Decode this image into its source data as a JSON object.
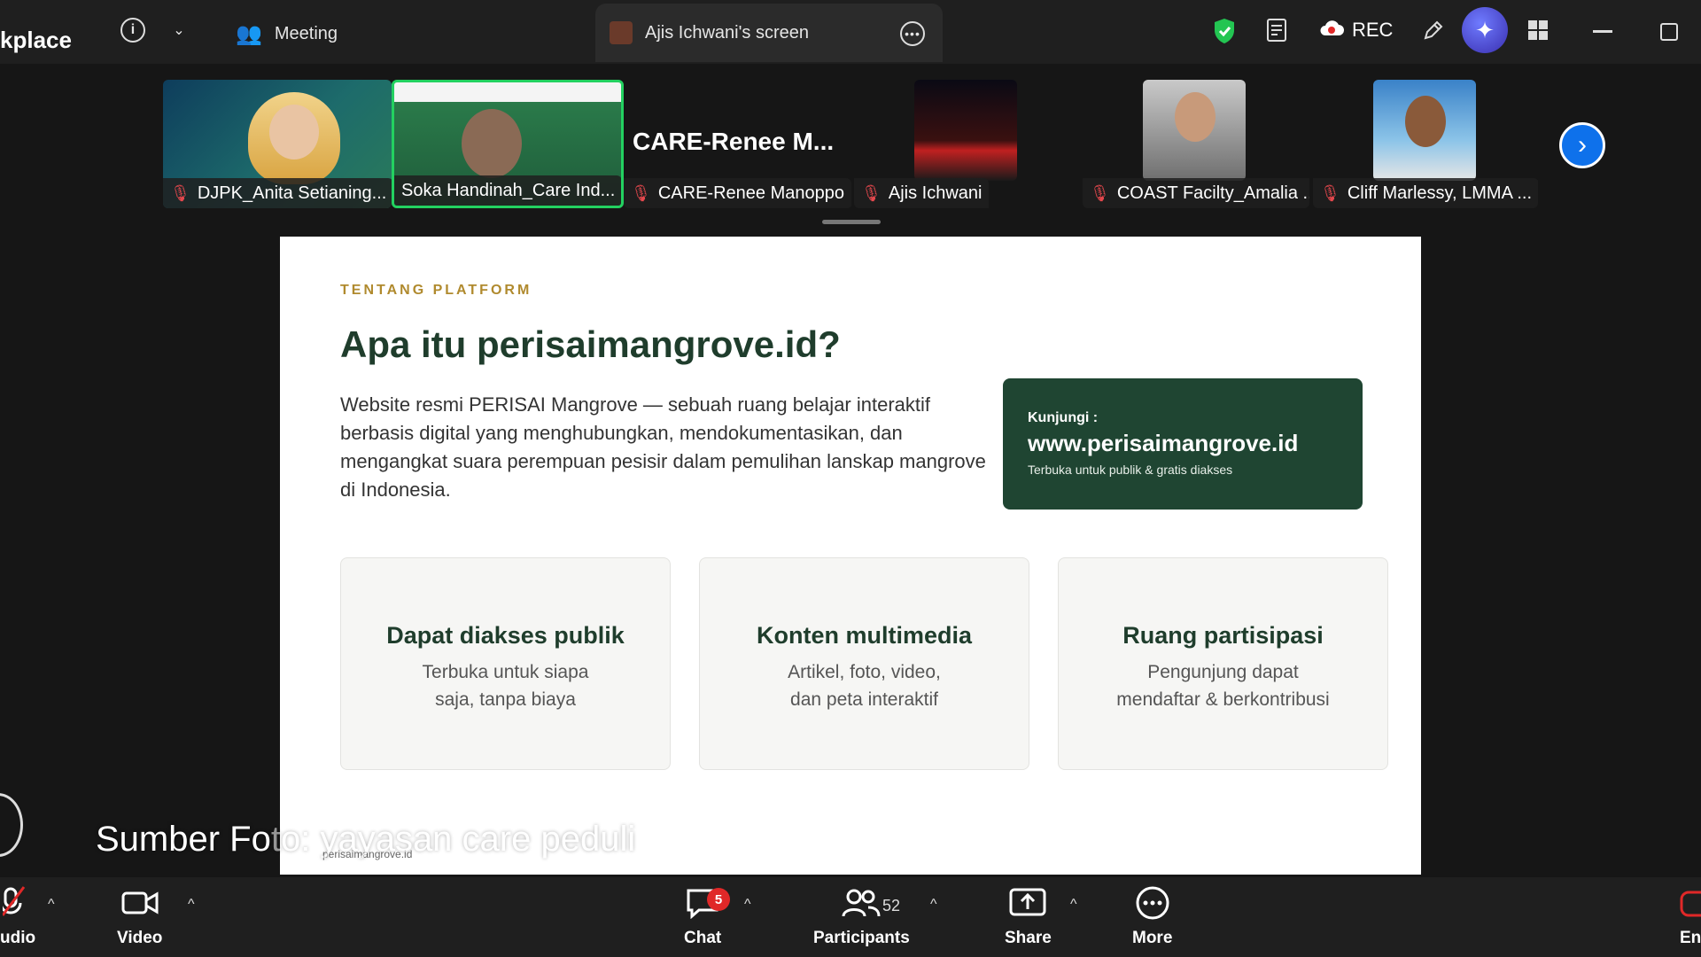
{
  "topbar": {
    "app_title": "kplace",
    "meeting_label": "Meeting",
    "screen_share_label": "Ajis Ichwani's screen",
    "rec_label": "REC"
  },
  "filmstrip": {
    "tiles": [
      {
        "name": "DJPK_Anita Setianing..."
      },
      {
        "name": "Soka Handinah_Care Ind..."
      },
      {
        "name": "CARE-Renee Manoppo",
        "placeholder": "CARE-Renee  M..."
      },
      {
        "name": "Ajis Ichwani"
      },
      {
        "name": "COAST Facilty_Amalia ..."
      },
      {
        "name": "Cliff Marlessy, LMMA ..."
      }
    ]
  },
  "slide": {
    "eyebrow": "TENTANG PLATFORM",
    "title": "Apa itu perisaimangrove.id?",
    "description": "Website resmi PERISAI Mangrove — sebuah ruang belajar interaktif berbasis digital yang menghubungkan, mendokumentasikan, dan mengangkat suara perempuan pesisir dalam pemulihan lanskap mangrove di Indonesia.",
    "visit": {
      "label": "Kunjungi :",
      "url": "www.perisaimangrove.id",
      "note": "Terbuka untuk publik & gratis diakses"
    },
    "features": [
      {
        "title": "Dapat diakses publik",
        "line1": "Terbuka untuk siapa",
        "line2": "saja, tanpa biaya"
      },
      {
        "title": "Konten multimedia",
        "line1": "Artikel, foto, video,",
        "line2": "dan peta interaktif"
      },
      {
        "title": "Ruang partisipasi",
        "line1": "Pengunjung dapat",
        "line2": "mendaftar & berkontribusi"
      }
    ],
    "footer": "perisaimangrove.id"
  },
  "caption": {
    "part1": "Sumber Fo",
    "part2": "to: yayasan care peduli"
  },
  "toolbar": {
    "audio_label": "udio",
    "video_label": "Video",
    "chat_label": "Chat",
    "chat_badge": "5",
    "participants_label": "Participants",
    "participants_count": "52",
    "share_label": "Share",
    "more_label": "More",
    "end_label": "En"
  },
  "colors": {
    "slide_green": "#1f4532",
    "eyebrow_gold": "#b08a2e",
    "active_tile_border": "#23d160",
    "accent_blue": "#0e71eb",
    "mute_red": "#e5484d"
  }
}
